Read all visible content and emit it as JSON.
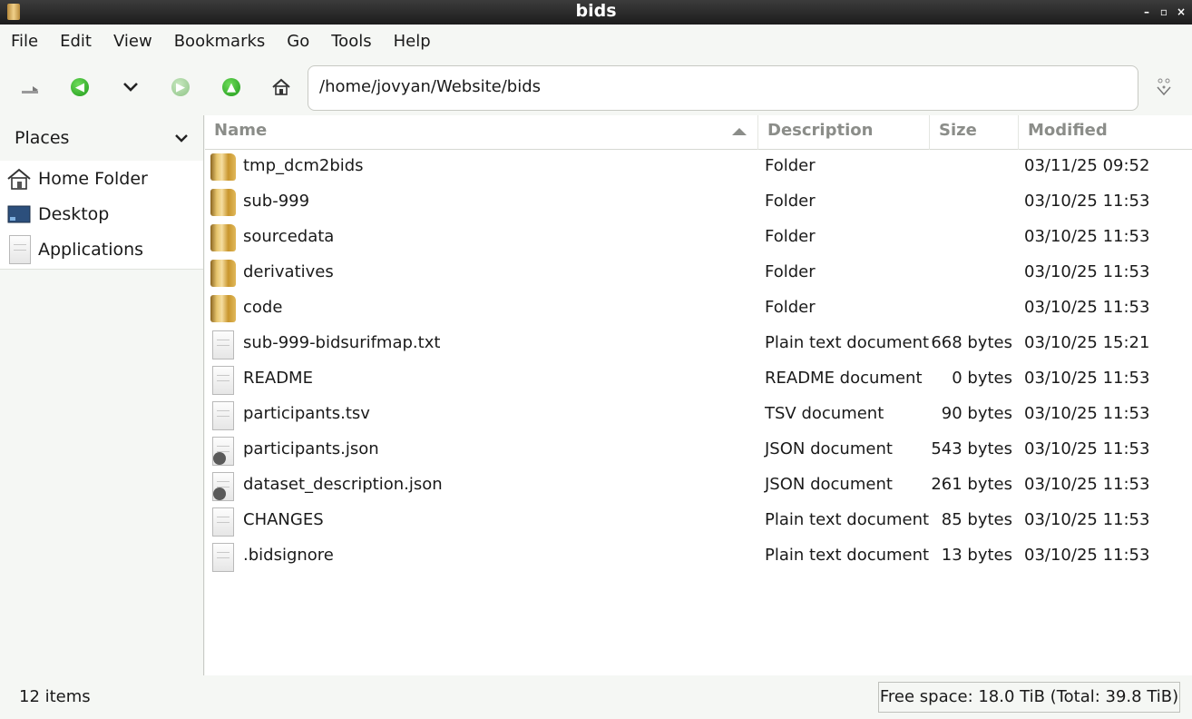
{
  "window": {
    "title": "bids"
  },
  "menubar": [
    "File",
    "Edit",
    "View",
    "Bookmarks",
    "Go",
    "Tools",
    "Help"
  ],
  "toolbar": {
    "location": "/home/jovyan/Website/bids"
  },
  "sidebar": {
    "header": "Places",
    "items": [
      {
        "label": "Home Folder",
        "icon": "home-folder-icon"
      },
      {
        "label": "Desktop",
        "icon": "desktop-icon"
      },
      {
        "label": "Applications",
        "icon": "applications-icon"
      }
    ]
  },
  "columns": {
    "name": "Name",
    "description": "Description",
    "size": "Size",
    "modified": "Modified"
  },
  "files": [
    {
      "name": "tmp_dcm2bids",
      "description": "Folder",
      "size": "",
      "modified": "03/11/25 09:52",
      "icon": "folder-icon"
    },
    {
      "name": "sub-999",
      "description": "Folder",
      "size": "",
      "modified": "03/10/25 11:53",
      "icon": "folder-icon"
    },
    {
      "name": "sourcedata",
      "description": "Folder",
      "size": "",
      "modified": "03/10/25 11:53",
      "icon": "folder-icon"
    },
    {
      "name": "derivatives",
      "description": "Folder",
      "size": "",
      "modified": "03/10/25 11:53",
      "icon": "folder-icon"
    },
    {
      "name": "code",
      "description": "Folder",
      "size": "",
      "modified": "03/10/25 11:53",
      "icon": "folder-icon"
    },
    {
      "name": "sub-999-bidsurifmap.txt",
      "description": "Plain text document",
      "size": "668 bytes",
      "modified": "03/10/25 15:21",
      "icon": "text-file-icon"
    },
    {
      "name": "README",
      "description": "README document",
      "size": "0 bytes",
      "modified": "03/10/25 11:53",
      "icon": "text-file-icon"
    },
    {
      "name": "participants.tsv",
      "description": "TSV document",
      "size": "90 bytes",
      "modified": "03/10/25 11:53",
      "icon": "text-file-icon"
    },
    {
      "name": "participants.json",
      "description": "JSON document",
      "size": "543 bytes",
      "modified": "03/10/25 11:53",
      "icon": "json-file-icon"
    },
    {
      "name": "dataset_description.json",
      "description": "JSON document",
      "size": "261 bytes",
      "modified": "03/10/25 11:53",
      "icon": "json-file-icon"
    },
    {
      "name": "CHANGES",
      "description": "Plain text document",
      "size": "85 bytes",
      "modified": "03/10/25 11:53",
      "icon": "text-file-icon"
    },
    {
      "name": ".bidsignore",
      "description": "Plain text document",
      "size": "13 bytes",
      "modified": "03/10/25 11:53",
      "icon": "text-file-icon"
    }
  ],
  "statusbar": {
    "count": "12 items",
    "freespace": "Free space: 18.0 TiB (Total: 39.8 TiB)"
  }
}
